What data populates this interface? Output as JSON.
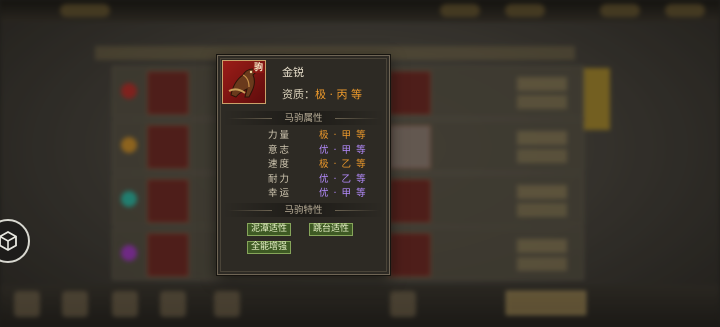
{
  "horse": {
    "name": "金锐",
    "portrait_tag": "驹",
    "quality_label": "资质：",
    "quality_value": "极 · 丙 等"
  },
  "attributes_section_title": "马驹属性",
  "attributes": [
    {
      "label": "力量",
      "value": "极 · 甲 等",
      "color": "#ee9a2b"
    },
    {
      "label": "意志",
      "value": "优 · 甲 等",
      "color": "#b58cff"
    },
    {
      "label": "速度",
      "value": "极 · 乙 等",
      "color": "#ee9a2b"
    },
    {
      "label": "耐力",
      "value": "优 · 乙 等",
      "color": "#b58cff"
    },
    {
      "label": "幸运",
      "value": "优 · 甲 等",
      "color": "#b58cff"
    }
  ],
  "traits_section_title": "马驹特性",
  "traits": [
    "泥潭适性",
    "跳台适性",
    "全能增强"
  ],
  "colors": {
    "accent_orange": "#ee9a2b",
    "accent_purple": "#b58cff",
    "trait_green": "#3e5a24",
    "panel_bg": "#2d2a24"
  },
  "icons": {
    "side_button": "hexagon-cube-icon"
  }
}
